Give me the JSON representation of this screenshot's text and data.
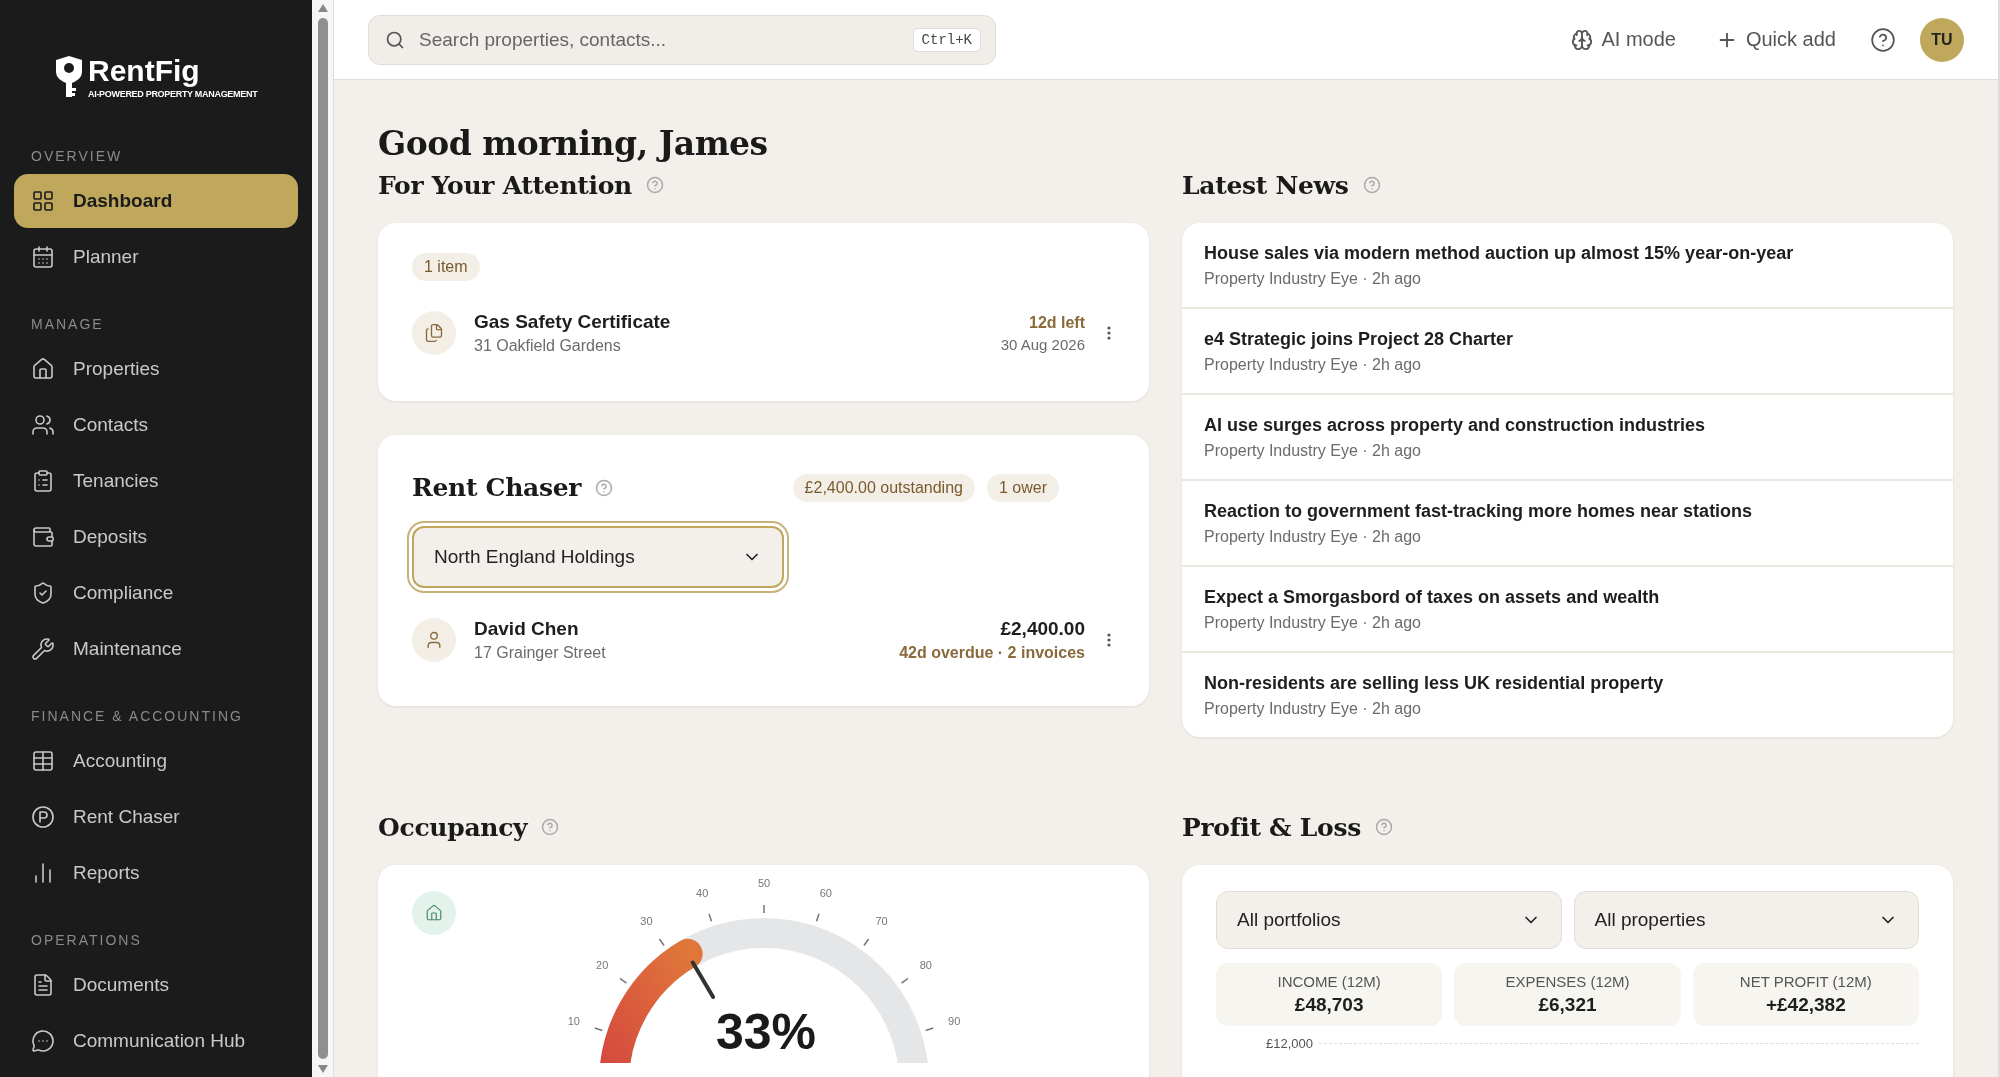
{
  "sidebar": {
    "logo": {
      "name": "RentFig",
      "tagline": "AI-POWERED PROPERTY MANAGEMENT"
    },
    "sections": [
      {
        "title": "OVERVIEW",
        "items": [
          {
            "label": "Dashboard",
            "selected": true
          },
          {
            "label": "Planner",
            "selected": false
          }
        ]
      },
      {
        "title": "MANAGE",
        "items": [
          {
            "label": "Properties",
            "selected": false
          },
          {
            "label": "Contacts",
            "selected": false
          },
          {
            "label": "Tenancies",
            "selected": false
          },
          {
            "label": "Deposits",
            "selected": false
          },
          {
            "label": "Compliance",
            "selected": false
          },
          {
            "label": "Maintenance",
            "selected": false
          }
        ]
      },
      {
        "title": "FINANCE & ACCOUNTING",
        "items": [
          {
            "label": "Accounting",
            "selected": false
          },
          {
            "label": "Rent Chaser",
            "selected": false
          },
          {
            "label": "Reports",
            "selected": false
          }
        ]
      },
      {
        "title": "OPERATIONS",
        "items": [
          {
            "label": "Documents",
            "selected": false
          },
          {
            "label": "Communication Hub",
            "selected": false
          }
        ]
      }
    ]
  },
  "topbar": {
    "search": {
      "placeholder": "Search properties, contacts...",
      "shortcut": "Ctrl+K"
    },
    "actions": [
      "AI mode",
      "Quick add"
    ],
    "avatar": "TU"
  },
  "greeting": "Good morning, James",
  "attention": {
    "title": "For Your Attention",
    "count": "1 item",
    "items": [
      {
        "title": "Gas Safety Certificate",
        "subtitle": "31 Oakfield Gardens",
        "status": "12d left",
        "date": "30 Aug 2026"
      }
    ]
  },
  "rent_chaser": {
    "title": "Rent Chaser",
    "badges": [
      "£2,400.00 outstanding",
      "1 ower"
    ],
    "portfolio": "North England Holdings",
    "owers": [
      {
        "name": "David Chen",
        "address": "17 Grainger Street",
        "amount": "£2,400.00",
        "detail": "42d overdue · 2 invoices"
      }
    ]
  },
  "news": {
    "title": "Latest News",
    "items": [
      {
        "headline": "House sales via modern method auction up almost 15% year-on-year",
        "source": "Property Industry Eye · 2h ago"
      },
      {
        "headline": "e4 Strategic joins Project 28 Charter",
        "source": "Property Industry Eye · 2h ago"
      },
      {
        "headline": "AI use surges across property and construction industries",
        "source": "Property Industry Eye · 2h ago"
      },
      {
        "headline": "Reaction to government fast-tracking more homes near stations",
        "source": "Property Industry Eye · 2h ago"
      },
      {
        "headline": "Expect a Smorgasbord of taxes on assets and wealth",
        "source": "Property Industry Eye · 2h ago"
      },
      {
        "headline": "Non-residents are selling less UK residential property",
        "source": "Property Industry Eye · 2h ago"
      }
    ]
  },
  "occupancy": {
    "title": "Occupancy",
    "level": 0.33,
    "reading": "33%",
    "ticks": [
      "10",
      "20",
      "30",
      "40",
      "50",
      "60",
      "70",
      "80",
      "90"
    ]
  },
  "profit_loss": {
    "title": "Profit & Loss",
    "filters": [
      "All portfolios",
      "All properties"
    ],
    "stats": [
      {
        "label": "INCOME (12M)",
        "value": "£48,703"
      },
      {
        "label": "EXPENSES (12M)",
        "value": "£6,321"
      },
      {
        "label": "NET PROFIT (12M)",
        "value": "+£42,382"
      }
    ],
    "axis_label": "£12,000"
  }
}
